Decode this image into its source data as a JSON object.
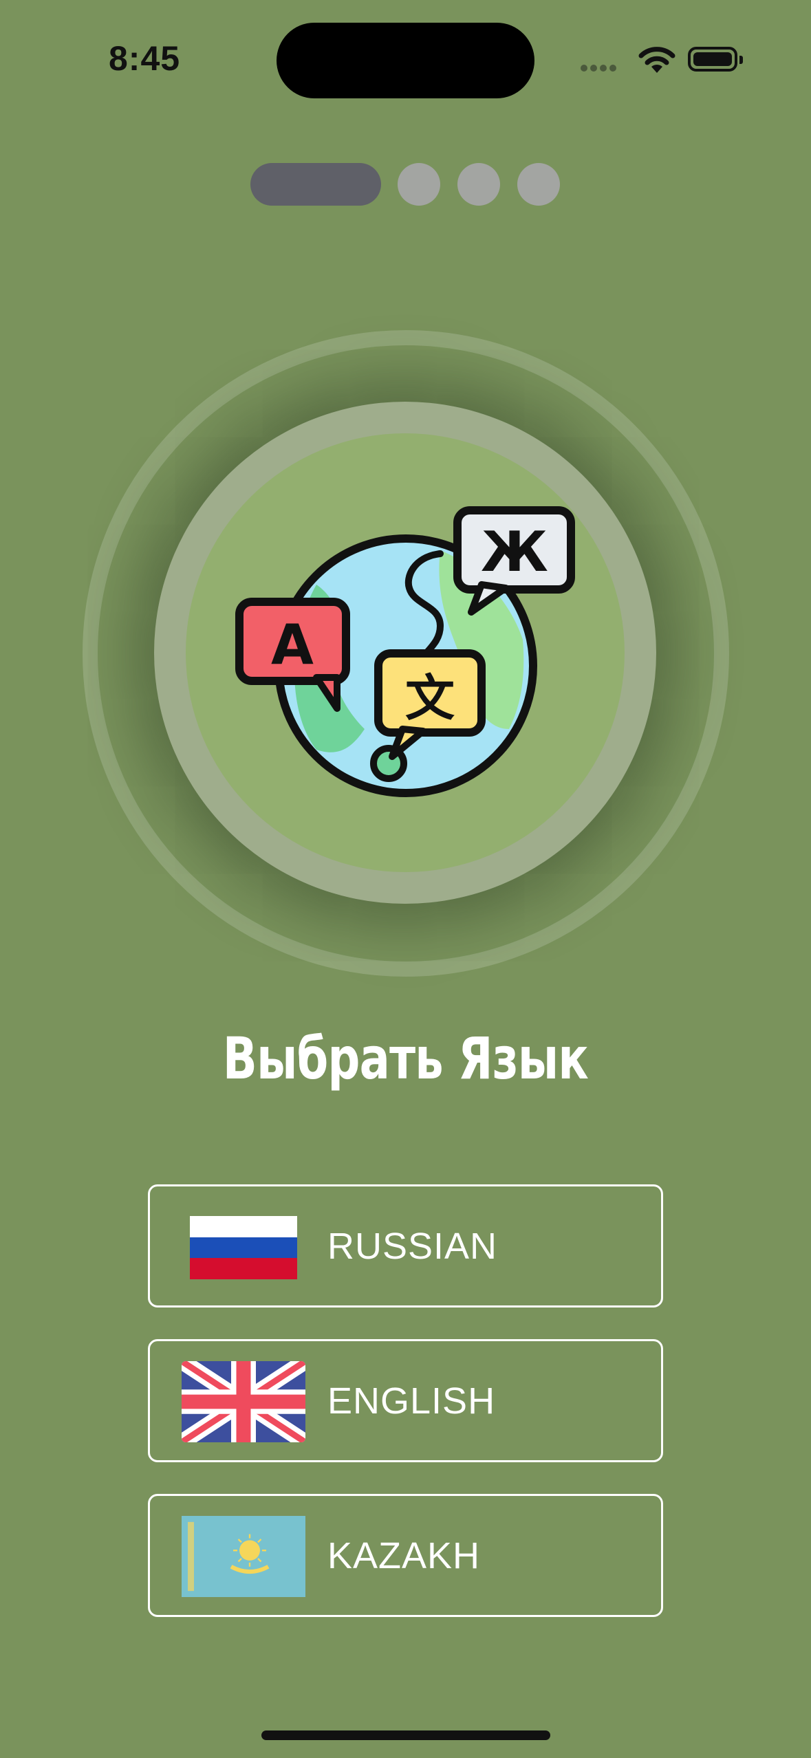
{
  "status_bar": {
    "time": "8:45"
  },
  "pager": {
    "total_pages": 4,
    "current_page": 1
  },
  "hero": {
    "icon": "translate-globe-icon",
    "bubble_letters": [
      "A",
      "文",
      "Ж"
    ]
  },
  "title": "Выбрать Язык",
  "languages": [
    {
      "label": "RUSSIAN",
      "flag": "russia-flag-icon"
    },
    {
      "label": "ENGLISH",
      "flag": "uk-flag-icon"
    },
    {
      "label": "KAZAKH",
      "flag": "kazakhstan-flag-icon"
    }
  ],
  "colors": {
    "background": "#7a935c",
    "inner_circle": "#93af6f",
    "pager_active": "#5f6068",
    "pager_inactive": "#a3a5a2",
    "text": "#ffffff"
  }
}
